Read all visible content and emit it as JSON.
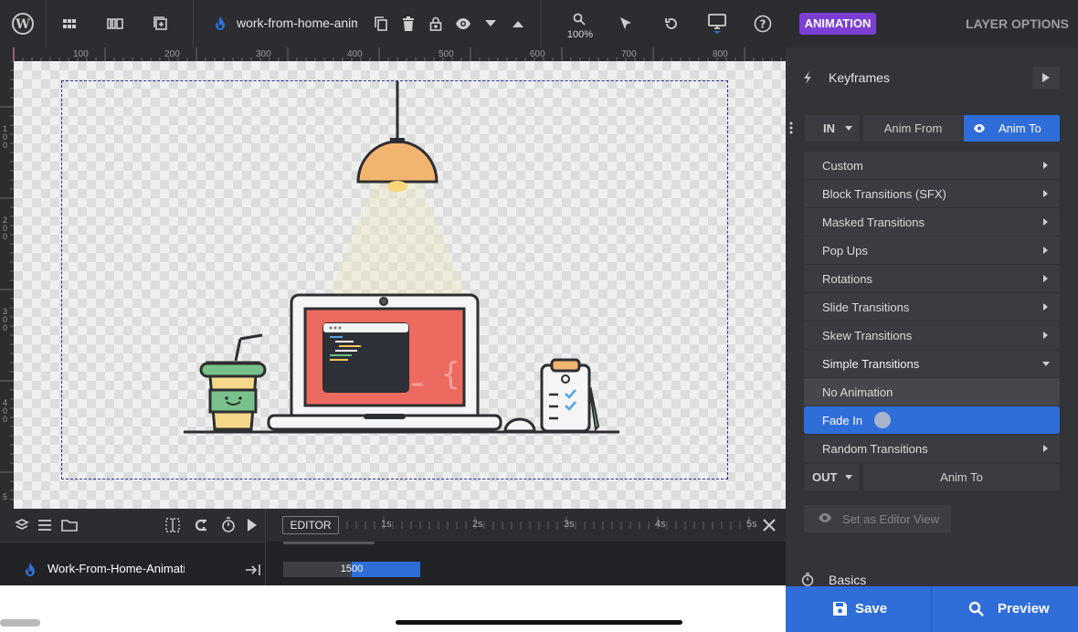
{
  "toolbar": {
    "filename": "work-from-home-animation",
    "zoom": "100%"
  },
  "ruler": {
    "h_labels": [
      "100",
      "200",
      "300",
      "400",
      "500",
      "600",
      "700",
      "800"
    ],
    "v_labels": [
      "1",
      "0",
      "0",
      "2",
      "0",
      "0",
      "3",
      "0",
      "0",
      "4",
      "0",
      "0",
      "5"
    ]
  },
  "timeline": {
    "editor_label": "EDITOR",
    "ticks": [
      "1s",
      "2s",
      "3s",
      "4s",
      "5s"
    ],
    "layer_name": "Work-From-Home-Animation",
    "layer_duration": "1500"
  },
  "panel": {
    "tab_animation": "ANIMATION",
    "tab_layer_options": "LAYER OPTIONS",
    "keyframes_title": "Keyframes",
    "in_select": "IN",
    "anim_from": "Anim From",
    "anim_to": "Anim To",
    "transitions": [
      "Custom",
      "Block Transitions (SFX)",
      "Masked Transitions",
      "Pop Ups",
      "Rotations",
      "Slide Transitions",
      "Skew Transitions",
      "Simple Transitions"
    ],
    "simple_sub": [
      "No Animation",
      "Fade In"
    ],
    "random_transitions": "Random Transitions",
    "out_select": "OUT",
    "out_anim_to": "Anim To",
    "set_editor_view": "Set as Editor View",
    "basics_title": "Basics"
  },
  "footer": {
    "save": "Save",
    "preview": "Preview"
  },
  "colors": {
    "accent_blue": "#2f6ed9",
    "accent_purple": "#7b3fd3",
    "panel_bg": "#333438",
    "toolbar_bg": "#2c2d30"
  }
}
